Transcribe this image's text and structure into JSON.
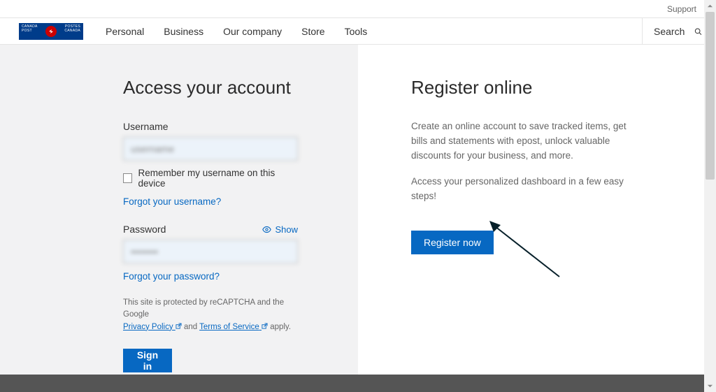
{
  "topBar": {
    "support": "Support"
  },
  "logo": {
    "left1": "CANADA",
    "left2": "POST",
    "right1": "POSTES",
    "right2": "CANADA"
  },
  "nav": {
    "personal": "Personal",
    "business": "Business",
    "company": "Our company",
    "store": "Store",
    "tools": "Tools"
  },
  "search": {
    "label": "Search"
  },
  "login": {
    "heading": "Access your account",
    "usernameLabel": "Username",
    "usernameValue": "username",
    "remember": "Remember my username on this device",
    "forgotUsername": "Forgot your username?",
    "passwordLabel": "Password",
    "passwordValue": "••••••••",
    "show": "Show",
    "forgotPassword": "Forgot your password?",
    "recaptchaPre": "This site is protected by reCAPTCHA and the Google ",
    "privacy": "Privacy Policy",
    "and": " and ",
    "tos": "Terms of Service",
    "apply": " apply.",
    "signin": "Sign in"
  },
  "register": {
    "heading": "Register online",
    "desc1": "Create an online account to save tracked items, get bills and statements with epost, unlock valuable discounts for your business, and more.",
    "desc2": "Access your personalized dashboard in a few easy steps!",
    "button": "Register now"
  }
}
